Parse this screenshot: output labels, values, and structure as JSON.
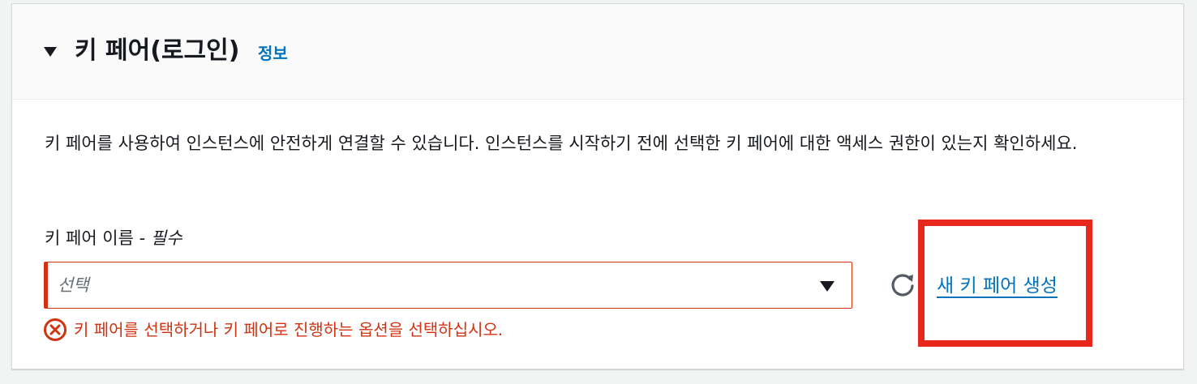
{
  "header": {
    "title": "키 페어(로그인)",
    "info_link": "정보"
  },
  "description": "키 페어를 사용하여 인스턴스에 안전하게 연결할 수 있습니다. 인스턴스를 시작하기 전에 선택한 키 페어에 대한 액세스 권한이 있는지 확인하세요.",
  "field": {
    "label": "키 페어 이름 - ",
    "required": "필수",
    "placeholder": "선택",
    "error": "키 페어를 선택하거나 키 페어로 진행하는 옵션을 선택하십시오."
  },
  "actions": {
    "create_link": "새 키 페어 생성",
    "refresh_icon": "refresh-icon"
  },
  "colors": {
    "error": "#d13212",
    "link": "#0073bb",
    "highlight": "#e8281c"
  }
}
